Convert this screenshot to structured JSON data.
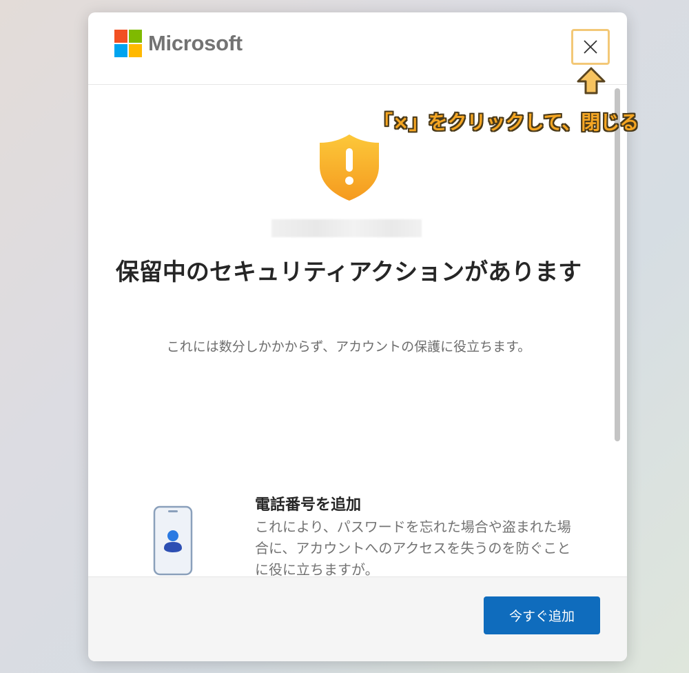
{
  "brand": {
    "name": "Microsoft",
    "colors": [
      "#f25022",
      "#7fba00",
      "#00a4ef",
      "#ffb900"
    ]
  },
  "dialog": {
    "close_icon": "close-icon",
    "title": "保留中のセキュリティアクションがあります",
    "subtitle": "これには数分しかかからず、アカウントの保護に役立ちます。",
    "feature": {
      "title": "電話番号を追加",
      "description": "これにより、パスワードを忘れた場合や盗まれた場合に、アカウントへのアクセスを失うのを防ぐことに役に立ちますが。"
    },
    "primary_button": "今すぐ追加",
    "accent_color": "#0f6cbd"
  },
  "annotation": {
    "callout": "「×」をクリックして、閉じる",
    "color": "#f5a623"
  }
}
